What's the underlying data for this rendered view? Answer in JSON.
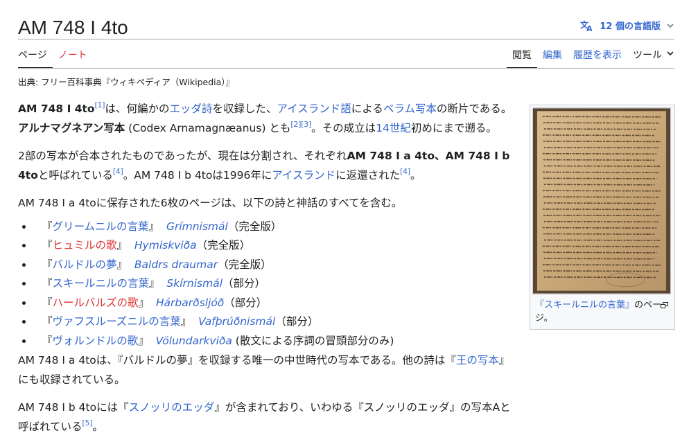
{
  "page": {
    "title": "AM 748 I 4to",
    "lang_button": "12 個の言語版",
    "source": "出典: フリー百科事典『ウィキペディア（Wikipedia）』"
  },
  "tabs": {
    "left": [
      {
        "label": "ページ",
        "active": true
      },
      {
        "label": "ノート",
        "red": true
      }
    ],
    "right": [
      {
        "label": "閲覧",
        "active": true
      },
      {
        "label": "編集"
      },
      {
        "label": "履歴を表示"
      },
      {
        "label": "ツール"
      }
    ]
  },
  "p1": {
    "b1": "AM 748 I 4to",
    "r1": "[1]",
    "t1": "は、何編かの",
    "l1": "エッダ詩",
    "t2": "を収録した、",
    "l2": "アイスランド語",
    "t3": "による",
    "l3": "ベラム",
    "l4": "写本",
    "t4": "の断片である。",
    "b2": "アルナマグネアン写本",
    "t5": " (Codex Arnamagnæanus) とも",
    "r2": "[2]",
    "r3": "[3]",
    "t6": "。その成立は",
    "l5": "14世紀",
    "t7": "初めにまで遡る。"
  },
  "p2": {
    "t1": "2部の写本が合本されたものであったが、現在は分割され、それぞれ",
    "b1": "AM 748 I a 4to",
    "t2": "、",
    "b2": "AM 748 I b 4to",
    "t3": "と呼ばれている",
    "r1": "[4]",
    "t4": "。AM 748 I b 4toは1996年に",
    "l1": "アイスランド",
    "t5": "に返還された",
    "r2": "[4]",
    "t6": "。"
  },
  "p3": "AM 748 I a 4toに保存された6枚のページは、以下の詩と神話のすべてを含む。",
  "poems": [
    {
      "open": "『",
      "ja": "グリームニルの言葉",
      "close": "』",
      "ja_red": false,
      "on": "Grímnismál",
      "note": "（完全版）"
    },
    {
      "open": "『",
      "ja": "ヒュミルの歌",
      "close": "』",
      "ja_red": true,
      "on": "Hymiskviða",
      "note": "（完全版）"
    },
    {
      "open": "『",
      "ja": "バルドルの夢",
      "close": "』",
      "ja_red": false,
      "on": "Baldrs draumar",
      "note": "（完全版）"
    },
    {
      "open": "『",
      "ja": "スキールニルの言葉",
      "close": "』",
      "ja_red": false,
      "on": "Skírnismál",
      "note": "（部分）"
    },
    {
      "open": "『",
      "ja": "ハールバルズの歌",
      "close": "』",
      "ja_red": true,
      "on": "Hárbarðsljóð",
      "note": "（部分）"
    },
    {
      "open": "『",
      "ja": "ヴァフスルーズニルの言葉",
      "close": "』",
      "ja_red": false,
      "on": "Vafþrúðnismál",
      "note": "（部分）"
    },
    {
      "open": "『",
      "ja": "ヴォルンドルの歌",
      "close": "』",
      "ja_red": false,
      "on": "Völundarkviða",
      "note": " (散文による序詞の冒頭部分のみ)"
    }
  ],
  "p4": {
    "t1": "AM 748 I a 4toは、『バルドルの夢』を収録する唯一の中世時代の写本である。他の詩は『",
    "l1": "王の写本",
    "t2": "』にも収録されている。"
  },
  "p5": {
    "t1": "AM 748 I b 4toには『",
    "l1": "スノッリのエッダ",
    "t2": "』が含まれており、いわゆる『スノッリのエッダ』の写本Aと呼ばれている",
    "r1": "[5]",
    "t3": "。"
  },
  "thumb": {
    "caption_link": "『スキールニルの言葉』",
    "caption_rest": "のページ。"
  },
  "icons": {
    "translate": "translate-icon",
    "chevron": "chevron-down-icon",
    "magnify": "magnify-icon"
  },
  "colors": {
    "link": "#3366cc",
    "redlink": "#d33",
    "text": "#202122",
    "border": "#a2a9b1",
    "parchment": "#c9a878"
  }
}
